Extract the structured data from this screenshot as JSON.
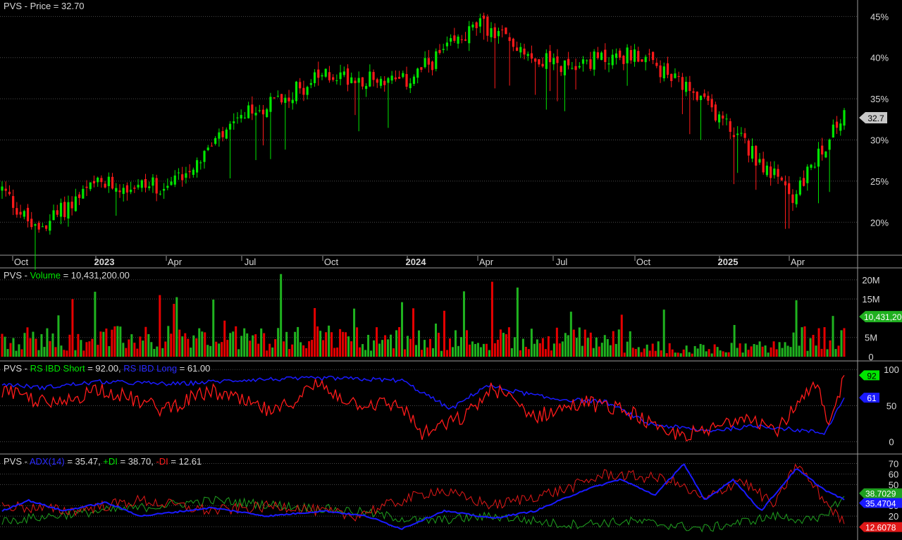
{
  "ticker": "PVS",
  "colors": {
    "background": "#000000",
    "grid": "#4a4a4a",
    "up": "#00e600",
    "down": "#ff1a1a",
    "yellow": "#ffff33",
    "blue": "#1a1aff",
    "text": "#d8d8d8"
  },
  "price_panel": {
    "label": "PVS - Price = 32.70",
    "last_badge": "32.7",
    "y_ticks": [
      "45%",
      "40%",
      "35%",
      "30%",
      "25%",
      "20%"
    ]
  },
  "x_axis": {
    "labels": [
      "Oct",
      "2023",
      "Apr",
      "Jul",
      "Oct",
      "2024",
      "Apr",
      "Jul",
      "Oct",
      "2025",
      "Apr"
    ],
    "bold": [
      false,
      true,
      false,
      false,
      false,
      true,
      false,
      false,
      false,
      true,
      false
    ]
  },
  "volume_panel": {
    "prefix": "PVS - ",
    "name": "Volume",
    "suffix": " = 10,431,200.00",
    "last_badge": "10,431,200",
    "y_ticks": [
      "20M",
      "15M",
      "5M",
      "0"
    ]
  },
  "rs_panel": {
    "prefix": "PVS - ",
    "name_short": "RS IBD Short",
    "value_short": " = 92.00, ",
    "name_long": "RS IBD Long",
    "value_long": " = 61.00",
    "badge_short": "92",
    "badge_long": "61",
    "y_ticks": [
      "100",
      "50",
      "0"
    ]
  },
  "adx_panel": {
    "prefix": "PVS - ",
    "name_adx": "ADX(14)",
    "value_adx": " = 35.47, ",
    "name_pdi": "+DI",
    "value_pdi": " = 38.70, ",
    "name_mdi": "-DI",
    "value_mdi": " = 12.61",
    "badge_pdi": "38.7029",
    "badge_adx": "35.4704",
    "badge_mdi": "12.6078",
    "y_ticks": [
      "70",
      "60",
      "50",
      "30",
      "20",
      "10"
    ]
  },
  "chart_data": [
    {
      "type": "candlestick",
      "title": "PVS - Price = 32.70",
      "ylim": [
        16,
        47
      ],
      "x_anchors": [
        "Aug 2022",
        "Oct 2022",
        "Jan 2023",
        "Apr 2023",
        "Jul 2023",
        "Oct 2023",
        "Jan 2024",
        "Apr 2024",
        "Jul 2024",
        "Oct 2024",
        "Jan 2025",
        "Apr 2025",
        "Jun 2025"
      ],
      "close_anchors": [
        24,
        19,
        24.5,
        24.5,
        33,
        38,
        37,
        44,
        39,
        40.5,
        33,
        23,
        32.7
      ],
      "last": 32.7
    },
    {
      "type": "bar",
      "title": "Volume",
      "ylim": [
        0,
        22
      ],
      "unit": "M",
      "last": 10.4312
    },
    {
      "type": "line",
      "title": "RS IBD",
      "ylim": [
        -15,
        110
      ],
      "series": [
        {
          "name": "RS IBD Short",
          "last": 92
        },
        {
          "name": "RS IBD Long",
          "last": 61
        }
      ]
    },
    {
      "type": "line",
      "title": "ADX(14)",
      "ylim": [
        0,
        75
      ],
      "series": [
        {
          "name": "ADX(14)",
          "last": 35.47
        },
        {
          "name": "+DI",
          "last": 38.7
        },
        {
          "name": "-DI",
          "last": 12.61
        }
      ]
    }
  ]
}
